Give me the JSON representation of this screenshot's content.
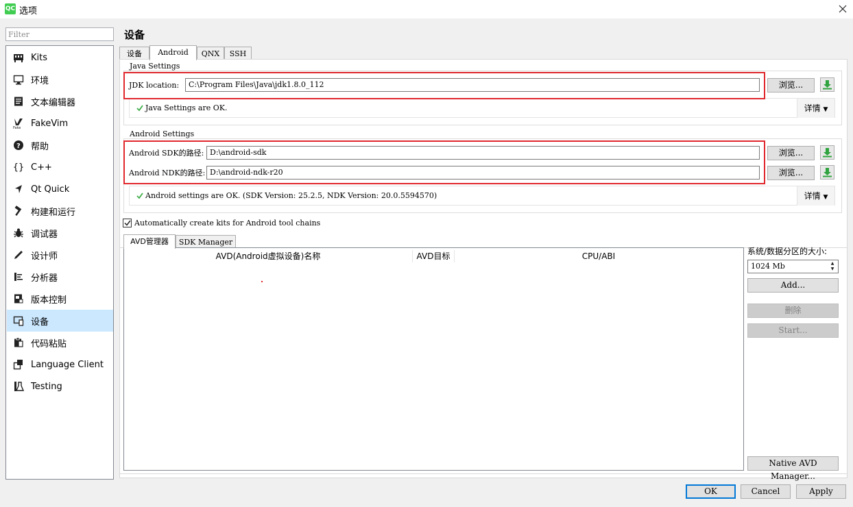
{
  "window": {
    "title": "选项",
    "app_icon": "QC"
  },
  "filter": {
    "placeholder": "Filter"
  },
  "sidebar": {
    "items": [
      {
        "label": "Kits",
        "icon": "kits-icon"
      },
      {
        "label": "环境",
        "icon": "monitor-icon"
      },
      {
        "label": "文本编辑器",
        "icon": "text-editor-icon"
      },
      {
        "label": "FakeVim",
        "icon": "fakevim-icon"
      },
      {
        "label": "帮助",
        "icon": "help-icon"
      },
      {
        "label": "C++",
        "icon": "braces-icon"
      },
      {
        "label": "Qt Quick",
        "icon": "qtquick-icon"
      },
      {
        "label": "构建和运行",
        "icon": "hammer-icon"
      },
      {
        "label": "调试器",
        "icon": "bug-icon"
      },
      {
        "label": "设计师",
        "icon": "pencil-icon"
      },
      {
        "label": "分析器",
        "icon": "analyzer-icon"
      },
      {
        "label": "版本控制",
        "icon": "version-control-icon"
      },
      {
        "label": "设备",
        "icon": "device-icon"
      },
      {
        "label": "代码粘贴",
        "icon": "clipboard-icon"
      },
      {
        "label": "Language Client",
        "icon": "language-client-icon"
      },
      {
        "label": "Testing",
        "icon": "testing-icon"
      }
    ],
    "active_index": 12
  },
  "page": {
    "title": "设备"
  },
  "tabs": [
    {
      "label": "设备"
    },
    {
      "label": "Android"
    },
    {
      "label": "QNX"
    },
    {
      "label": "SSH"
    }
  ],
  "java": {
    "group_title": "Java Settings",
    "jdk_label": "JDK location:",
    "jdk_value": "C:\\Program Files\\Java\\jdk1.8.0_112",
    "browse": "浏览...",
    "status": "Java Settings are OK.",
    "details": "详情"
  },
  "android": {
    "group_title": "Android Settings",
    "sdk_label": "Android SDK的路径:",
    "sdk_value": "D:\\android-sdk",
    "ndk_label": "Android NDK的路径:",
    "ndk_value": "D:\\android-ndk-r20",
    "browse": "浏览...",
    "status": "Android settings are OK. (SDK Version: 25.2.5, NDK Version: 20.0.5594570)",
    "details": "详情"
  },
  "auto_kits": {
    "label": "Automatically create kits for Android tool chains",
    "checked": true
  },
  "subtabs": [
    {
      "label": "AVD管理器"
    },
    {
      "label": "SDK Manager"
    }
  ],
  "avd_table": {
    "columns": [
      "AVD(Android虚拟设备)名称",
      "AVD目标",
      "CPU/ABI"
    ]
  },
  "avd_side": {
    "partition_label": "系统/数据分区的大小:",
    "partition_value": "1024 Mb",
    "add": "Add...",
    "delete": "删除",
    "start": "Start...",
    "native": "Native AVD Manager..."
  },
  "footer": {
    "ok": "OK",
    "cancel": "Cancel",
    "apply": "Apply"
  },
  "colors": {
    "highlight_box": "#e0262c",
    "selection": "#cce8ff",
    "check": "#3fae49",
    "download": "#2fa33e"
  }
}
